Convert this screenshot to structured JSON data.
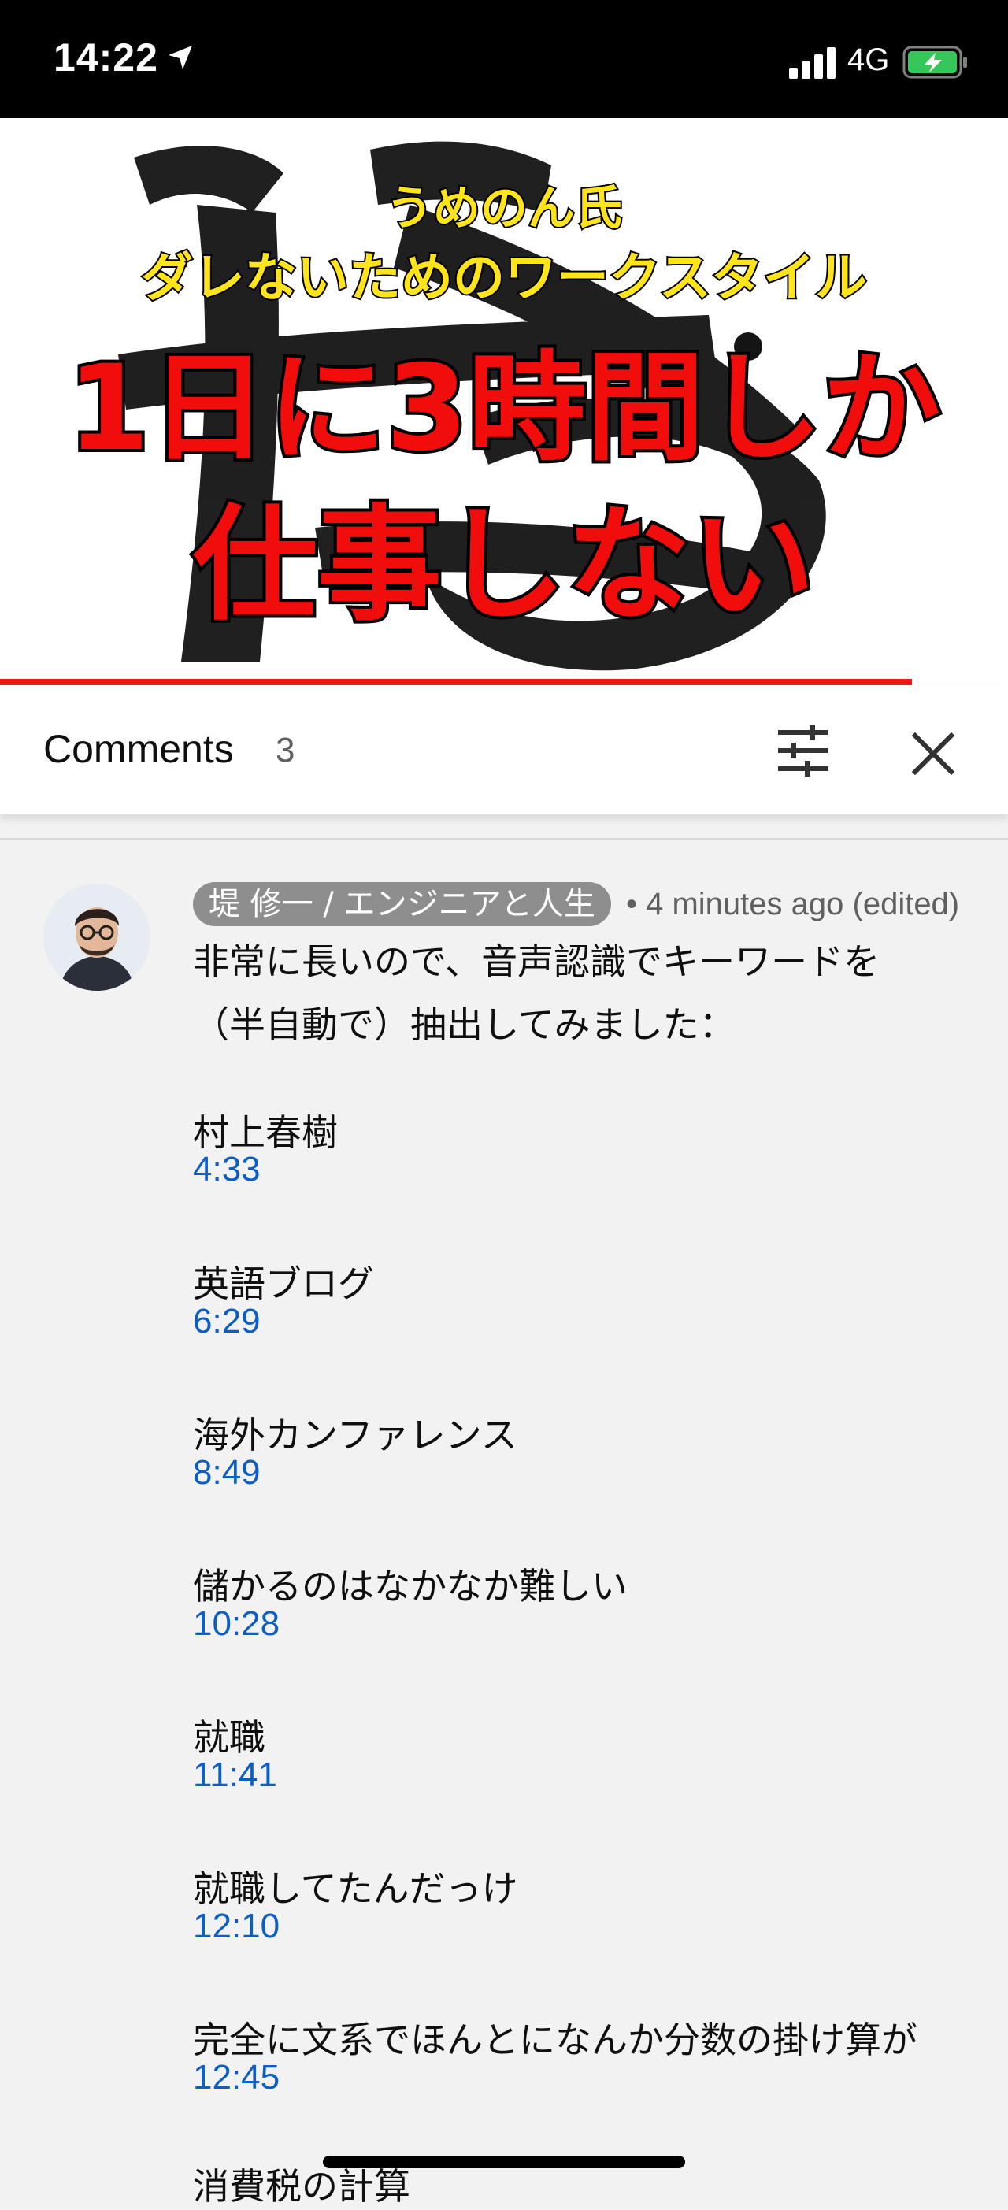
{
  "status_bar": {
    "time": "14:22",
    "network": "4G",
    "battery_color": "#35c759"
  },
  "video": {
    "line1": "うめのん氏",
    "line2": "ダレないためのワークスタイル",
    "line3": "1日に3時間しか",
    "line4": "仕事しない",
    "progress_fraction": 0.905,
    "accent": "#e51b1b"
  },
  "comments_header": {
    "title": "Comments",
    "count": "3",
    "filter_icon": "sliders-icon",
    "close_icon": "close-icon"
  },
  "comment": {
    "author": "堤 修一 / エンジニアと人生",
    "meta": "• 4 minutes ago (edited)",
    "text_lines": [
      "非常に長いので、音声認識でキーワードを",
      "（半自動で）抽出してみました："
    ],
    "keywords": [
      {
        "text": "村上春樹",
        "time": "4:33"
      },
      {
        "text": "英語ブログ",
        "time": "6:29"
      },
      {
        "text": "海外カンファレンス",
        "time": "8:49"
      },
      {
        "text": "儲かるのはなかなか難しい",
        "time": "10:28"
      },
      {
        "text": "就職",
        "time": "11:41"
      },
      {
        "text": "就職してたんだっけ",
        "time": "12:10"
      },
      {
        "text": "完全に文系でほんとになんか分数の掛け算が",
        "time": "12:45"
      },
      {
        "text": "消費税の計算",
        "time": ""
      }
    ],
    "link_color": "#0d5ec4"
  }
}
